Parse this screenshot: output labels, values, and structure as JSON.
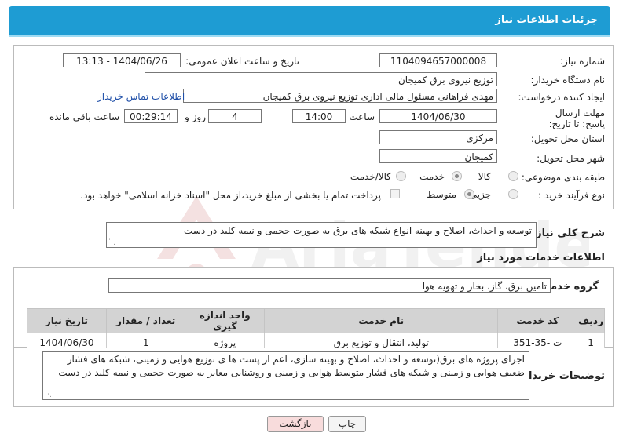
{
  "header": {
    "title": "جزئیات اطلاعات نیاز"
  },
  "form": {
    "need_number_label": "شماره نیاز:",
    "need_number": "1104094657000008",
    "announce_label": "تاریخ و ساعت اعلان عمومی:",
    "announce_value": "1404/06/26 - 13:13",
    "buyer_org_label": "نام دستگاه خریدار:",
    "buyer_org": "توزیع نیروی برق کمیجان",
    "creator_label": "ایجاد کننده درخواست:",
    "creator": "مهدی فراهانی مسئول مالی اداری توزیع نیروی برق کمیجان",
    "contact_link": "اطلاعات تماس خریدار",
    "deadline_label": "مهلت ارسال پاسخ: تا تاریخ:",
    "deadline_date": "1404/06/30",
    "time_label": "ساعت",
    "deadline_time": "14:00",
    "days_value": "4",
    "days_label": "روز و",
    "remaining_time": "00:29:14",
    "remaining_label": "ساعت باقی مانده",
    "province_label": "استان محل تحویل:",
    "province": "مرکزی",
    "city_label": "شهر محل تحویل:",
    "city": "کمیجان",
    "category_label": "طبقه بندی موضوعی:",
    "category_options": [
      "کالا",
      "خدمت",
      "کالا/خدمت"
    ],
    "category_selected": "خدمت",
    "process_label": "نوع فرآیند خرید :",
    "process_options": [
      "جزیی",
      "متوسط"
    ],
    "process_selected": "متوسط",
    "payment_text": "پرداخت تمام یا بخشی از مبلغ خرید،از محل \"اسناد خزانه اسلامی\" خواهد بود."
  },
  "summary": {
    "label": "شرح کلی نیاز:",
    "text": "توسعه و احداث، اصلاح و بهینه  انواع شبکه های برق به صورت حجمی و نیمه کلید در دست"
  },
  "services": {
    "section_title": "اطلاعات خدمات مورد نیاز",
    "group_label": "گروه خدمت:",
    "group_value": "تامین برق، گاز، بخار و تهویه هوا",
    "columns": [
      "ردیف",
      "کد خدمت",
      "نام خدمت",
      "واحد اندازه گیری",
      "تعداد / مقدار",
      "تاریخ نیاز"
    ],
    "rows": [
      [
        "1",
        "ت -35-351",
        "تولید، انتقال و توزیع برق",
        "پروژه",
        "1",
        "1404/06/30"
      ]
    ]
  },
  "buyer_notes": {
    "label": "توضیحات خریدار:",
    "text": "اجرای  پروژه های برق(توسعه و احداث، اصلاح و بهینه سازی،  اعم از پست ها ی توزیع هوایی و زمینی، شبکه های  فشار ضعیف هوایی و زمینی  و شبکه های فشار متوسط هوایی و زمینی و روشنایی معابر به صورت حجمی و نیمه کلید در دست"
  },
  "buttons": {
    "print": "چاپ",
    "back": "بازگشت"
  },
  "colors": {
    "header": "#1e9cd3",
    "link": "#1f4fa8",
    "back_button": "#f8dcdc"
  },
  "watermark": {
    "text": "AriaTender.neT"
  }
}
